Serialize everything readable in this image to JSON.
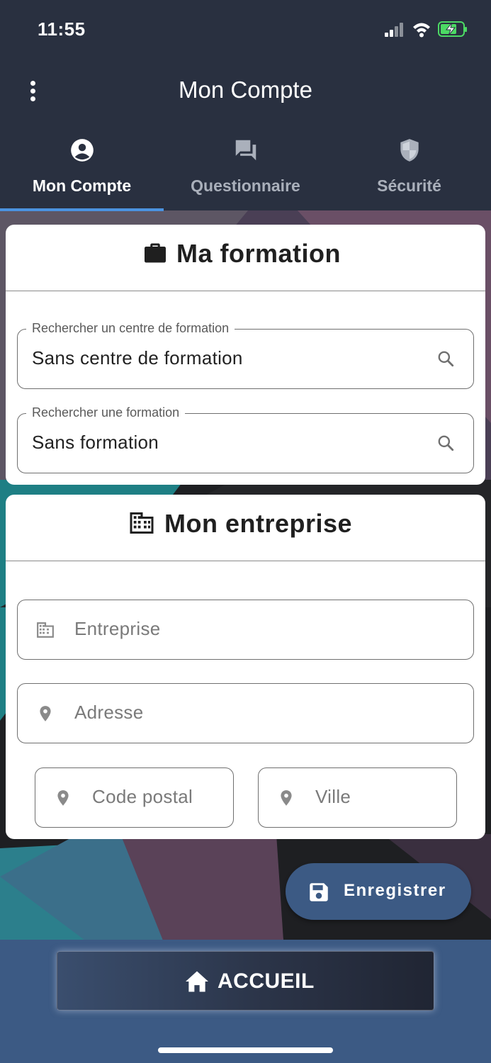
{
  "status_bar": {
    "time": "11:55"
  },
  "header": {
    "title": "Mon Compte",
    "menu_icon": "more-vert-icon"
  },
  "tabs": [
    {
      "label": "Mon Compte",
      "icon": "account-circle-icon",
      "active": true
    },
    {
      "label": "Questionnaire",
      "icon": "forum-icon",
      "active": false
    },
    {
      "label": "Sécurité",
      "icon": "shield-icon",
      "active": false
    }
  ],
  "formation": {
    "title": "Ma formation",
    "icon": "briefcase-icon",
    "centre_field": {
      "label": "Rechercher un centre de formation",
      "value": "Sans centre de formation",
      "icon": "search-icon"
    },
    "formation_field": {
      "label": "Rechercher une formation",
      "value": "Sans formation",
      "icon": "search-icon"
    }
  },
  "entreprise": {
    "title": "Mon entreprise",
    "icon": "business-icon",
    "company_field": {
      "placeholder": "Entreprise",
      "icon": "business-icon"
    },
    "address_field": {
      "placeholder": "Adresse",
      "icon": "location-pin-icon"
    },
    "postal_field": {
      "placeholder": "Code postal",
      "icon": "location-pin-icon"
    },
    "city_field": {
      "placeholder": "Ville",
      "icon": "location-pin-icon"
    }
  },
  "save_button": {
    "label": "Enregistrer",
    "icon": "save-icon"
  },
  "home_button": {
    "label": "ACCUEIL",
    "icon": "home-icon"
  },
  "colors": {
    "header": "#293040",
    "accent": "#3c5a84",
    "tab_indicator": "#4b93e0",
    "battery": "#4cd964"
  }
}
